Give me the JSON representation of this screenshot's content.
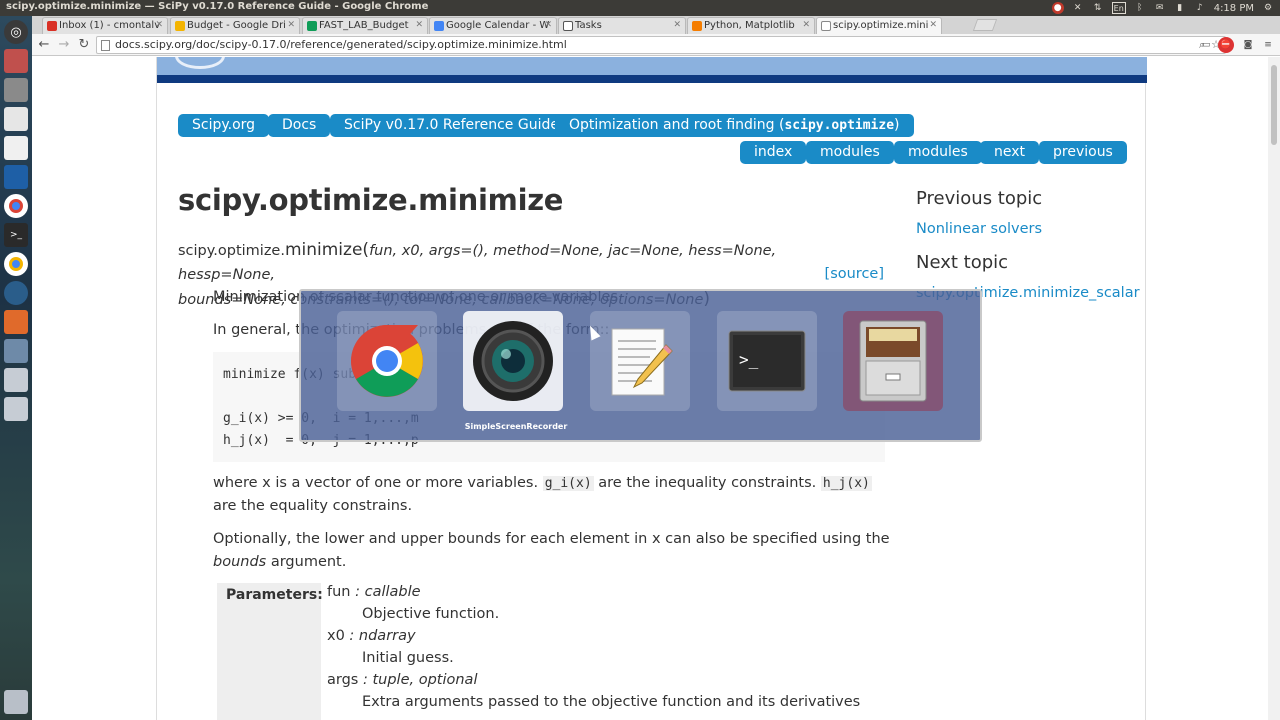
{
  "system": {
    "window_title": "scipy.optimize.minimize — SciPy v0.17.0 Reference Guide - Google Chrome",
    "keyboard": "En",
    "clock": "4:18 PM"
  },
  "tabs": [
    {
      "label": "Inbox (1) - cmontalv",
      "favicon": "gmail-icon",
      "color": "#d93025"
    },
    {
      "label": "Budget - Google Dri",
      "favicon": "drive-icon",
      "color": "#f4b400"
    },
    {
      "label": "FAST_LAB_Budget",
      "favicon": "sheets-icon",
      "color": "#0f9d58"
    },
    {
      "label": "Google Calendar - W",
      "favicon": "calendar-icon",
      "color": "#4285f4"
    },
    {
      "label": "Tasks",
      "favicon": "tasks-icon",
      "color": "#555555"
    },
    {
      "label": "Python, Matplotlib",
      "favicon": "blogger-icon",
      "color": "#f57d00"
    },
    {
      "label": "scipy.optimize.mini",
      "favicon": "page-icon",
      "color": "#888888"
    }
  ],
  "address": {
    "url": "docs.scipy.org/doc/scipy-0.17.0/reference/generated/scipy.optimize.minimize.html"
  },
  "breadcrumbs": {
    "scipy_org": "Scipy.org",
    "docs": "Docs",
    "ref_guide": "SciPy v0.17.0 Reference Guide",
    "optimize_prefix": "Optimization and root finding (",
    "optimize_code": "scipy.optimize",
    "optimize_suffix": ")"
  },
  "relnav": {
    "index": "index",
    "modules1": "modules",
    "modules2": "modules",
    "next": "next",
    "previous": "previous"
  },
  "page": {
    "title": "scipy.optimize.minimize",
    "sig_module": "scipy.optimize.",
    "sig_name": "minimize",
    "sig_open": "(",
    "sig_params_line1": "fun, x0, args=(), method=None, jac=None, hess=None, hessp=None,",
    "sig_params_line2": "bounds=None, constraints=(), tol=None, callback=None, options=None",
    "sig_close": ")",
    "source_link": "[source]",
    "para1": "Minimization of scalar function of one or more variables.",
    "para2": "In general, the optimization problems are of the form::",
    "code_l1": "minimize f(x) subject to",
    "code_l3": "g_i(x) >= 0,  i = 1,...,m",
    "code_l4": "h_j(x)  = 0,  j = 1,...,p",
    "para3_a": "where x is a vector of one or more variables. ",
    "para3_g": "g_i(x)",
    "para3_b": " are the inequality constraints. ",
    "para3_h": "h_j(x)",
    "para3_c": "are the equality constrains.",
    "para4_a": "Optionally, the lower and upper bounds for each element in x can also be specified using the",
    "para4_em": "bounds",
    "para4_b": " argument.",
    "params_label": "Parameters:",
    "params": [
      {
        "name": "fun",
        "type": " : callable",
        "desc": "Objective function."
      },
      {
        "name": "x0",
        "type": " : ndarray",
        "desc": "Initial guess."
      },
      {
        "name": "args",
        "type": " : tuple, optional",
        "desc": "Extra arguments passed to the objective function and its derivatives"
      }
    ]
  },
  "sidebar": {
    "prev_heading": "Previous topic",
    "prev_link": "Nonlinear solvers",
    "next_heading": "Next topic",
    "next_link": "scipy.optimize.minimize_scalar"
  },
  "switcher": {
    "selected_label": "SimpleScreenRecorder",
    "apps": [
      "chrome-icon",
      "screen-recorder-icon",
      "text-editor-icon",
      "terminal-icon",
      "file-cabinet-icon"
    ]
  }
}
